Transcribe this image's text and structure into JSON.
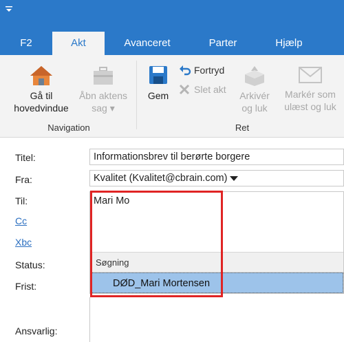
{
  "tabs": [
    {
      "label": "F2",
      "active": false
    },
    {
      "label": "Akt",
      "active": true
    },
    {
      "label": "Avanceret",
      "active": false
    },
    {
      "label": "Parter",
      "active": false
    },
    {
      "label": "Hjælp",
      "active": false
    }
  ],
  "ribbon": {
    "goto_main": {
      "line1": "Gå til",
      "line2": "hovedvindue",
      "icon": "home-icon"
    },
    "open_case": {
      "line1": "Åbn aktens",
      "line2": "sag ▾",
      "icon": "briefcase-icon"
    },
    "navigation_label": "Navigation",
    "save": {
      "label": "Gem",
      "icon": "save-icon"
    },
    "undo": {
      "label": "Fortryd",
      "icon": "undo-icon"
    },
    "delete": {
      "label": "Slet akt",
      "icon": "delete-x-icon"
    },
    "archive": {
      "line1": "Arkivér",
      "line2": "og luk",
      "icon": "archive-box-icon"
    },
    "mark_unread": {
      "line1": "Markér som",
      "line2": "ulæst og luk",
      "icon": "envelope-icon"
    },
    "ret_label": "Ret"
  },
  "form": {
    "title_label": "Titel:",
    "title_value": "Informationsbrev til berørte borgere",
    "from_label": "Fra:",
    "from_value": "Kvalitet (Kvalitet@cbrain.com)",
    "to_label": "Til:",
    "to_value": "Mari Mo",
    "cc_label": "Cc",
    "bcc_label": "Xbc",
    "status_label": "Status:",
    "deadline_label": "Frist:",
    "responsible_label": "Ansvarlig:"
  },
  "autocomplete": {
    "header": "Søgning",
    "items": [
      "DØD_Mari Mortensen"
    ]
  },
  "colors": {
    "accent": "#2b79c9",
    "ribbon_bg": "#f3f3f3",
    "selection": "#9dc3ea",
    "highlight": "#e02424",
    "link": "#2b6fc0"
  }
}
